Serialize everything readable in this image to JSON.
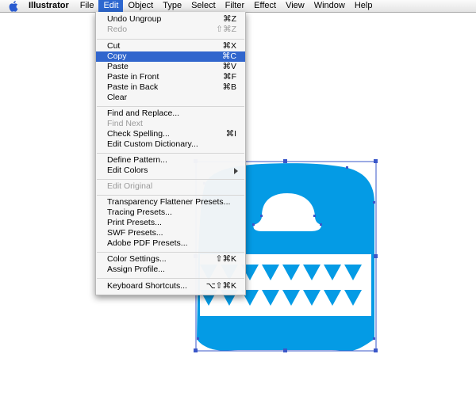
{
  "menubar": {
    "app_name": "Illustrator",
    "menus": [
      "File",
      "Edit",
      "Object",
      "Type",
      "Select",
      "Filter",
      "Effect",
      "View",
      "Window",
      "Help"
    ],
    "active_menu": "Edit"
  },
  "edit_menu": {
    "items": [
      {
        "label": "Undo Ungroup",
        "shortcut": "⌘Z",
        "state": "normal"
      },
      {
        "label": "Redo",
        "shortcut": "⇧⌘Z",
        "state": "disabled"
      },
      {
        "label": "Cut",
        "shortcut": "⌘X",
        "state": "normal"
      },
      {
        "label": "Copy",
        "shortcut": "⌘C",
        "state": "highlighted"
      },
      {
        "label": "Paste",
        "shortcut": "⌘V",
        "state": "normal"
      },
      {
        "label": "Paste in Front",
        "shortcut": "⌘F",
        "state": "normal"
      },
      {
        "label": "Paste in Back",
        "shortcut": "⌘B",
        "state": "normal"
      },
      {
        "label": "Clear",
        "shortcut": "",
        "state": "normal"
      },
      {
        "label": "Find and Replace...",
        "shortcut": "",
        "state": "normal"
      },
      {
        "label": "Find Next",
        "shortcut": "",
        "state": "disabled"
      },
      {
        "label": "Check Spelling...",
        "shortcut": "⌘I",
        "state": "normal"
      },
      {
        "label": "Edit Custom Dictionary...",
        "shortcut": "",
        "state": "normal"
      },
      {
        "label": "Define Pattern...",
        "shortcut": "",
        "state": "normal"
      },
      {
        "label": "Edit Colors",
        "shortcut": "",
        "state": "submenu"
      },
      {
        "label": "Edit Original",
        "shortcut": "",
        "state": "disabled"
      },
      {
        "label": "Transparency Flattener Presets...",
        "shortcut": "",
        "state": "normal"
      },
      {
        "label": "Tracing Presets...",
        "shortcut": "",
        "state": "normal"
      },
      {
        "label": "Print Presets...",
        "shortcut": "",
        "state": "normal"
      },
      {
        "label": "SWF Presets...",
        "shortcut": "",
        "state": "normal"
      },
      {
        "label": "Adobe PDF Presets...",
        "shortcut": "",
        "state": "normal"
      },
      {
        "label": "Color Settings...",
        "shortcut": "⇧⌘K",
        "state": "normal"
      },
      {
        "label": "Assign Profile...",
        "shortcut": "",
        "state": "normal"
      },
      {
        "label": "Keyboard Shortcuts...",
        "shortcut": "⌥⇧⌘K",
        "state": "normal"
      }
    ]
  },
  "colors": {
    "artwork_fill": "#049be5",
    "selection": "#3a57c9",
    "menu_highlight": "#3166cd"
  },
  "icons": {
    "apple": "apple-icon",
    "submenu_arrow": "chevron-right-icon"
  }
}
